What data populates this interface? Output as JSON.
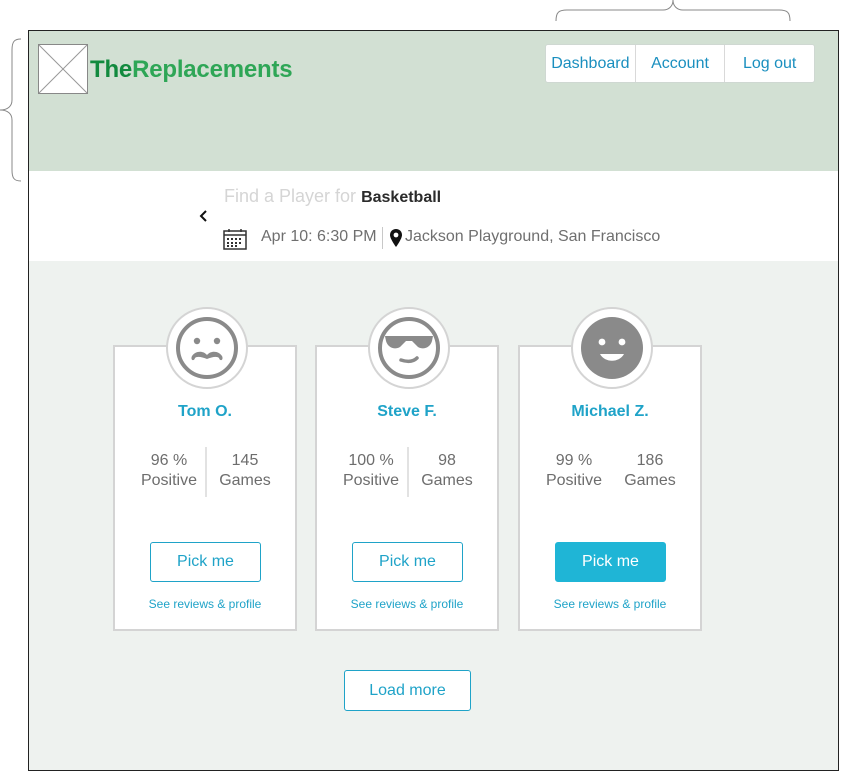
{
  "header": {
    "brand_part1": "The",
    "brand_part2": "Replacements",
    "nav": [
      "Dashboard",
      "Account",
      "Log out"
    ]
  },
  "context": {
    "find_prefix": "Find a Player for",
    "sport": "Basketball",
    "datetime": "Apr 10: 6:30 PM",
    "location": "Jackson Playground, San Francisco"
  },
  "players": [
    {
      "name": "Tom O.",
      "positive": "96 %",
      "positive_label": "Positive",
      "games": "145",
      "games_label": "Games",
      "pick_label": "Pick me",
      "reviews_label": "See reviews & profile",
      "avatar": "mustache-face-icon"
    },
    {
      "name": "Steve F.",
      "positive": "100 %",
      "positive_label": "Positive",
      "games": "98",
      "games_label": "Games",
      "pick_label": "Pick me",
      "reviews_label": "See reviews & profile",
      "avatar": "sunglasses-face-icon"
    },
    {
      "name": "Michael Z.",
      "positive": "99 %",
      "positive_label": "Positive",
      "games": "186",
      "games_label": "Games",
      "pick_label": "Pick me",
      "reviews_label": "See reviews & profile",
      "avatar": "smiley-face-icon",
      "selected": true
    }
  ],
  "load_more_label": "Load more",
  "colors": {
    "header_bg": "#d2e0d3",
    "accent": "#1fa3c8",
    "accent_selected": "#1fb5d6",
    "brand_dark": "#128a3e",
    "brand_light": "#2ea656"
  }
}
